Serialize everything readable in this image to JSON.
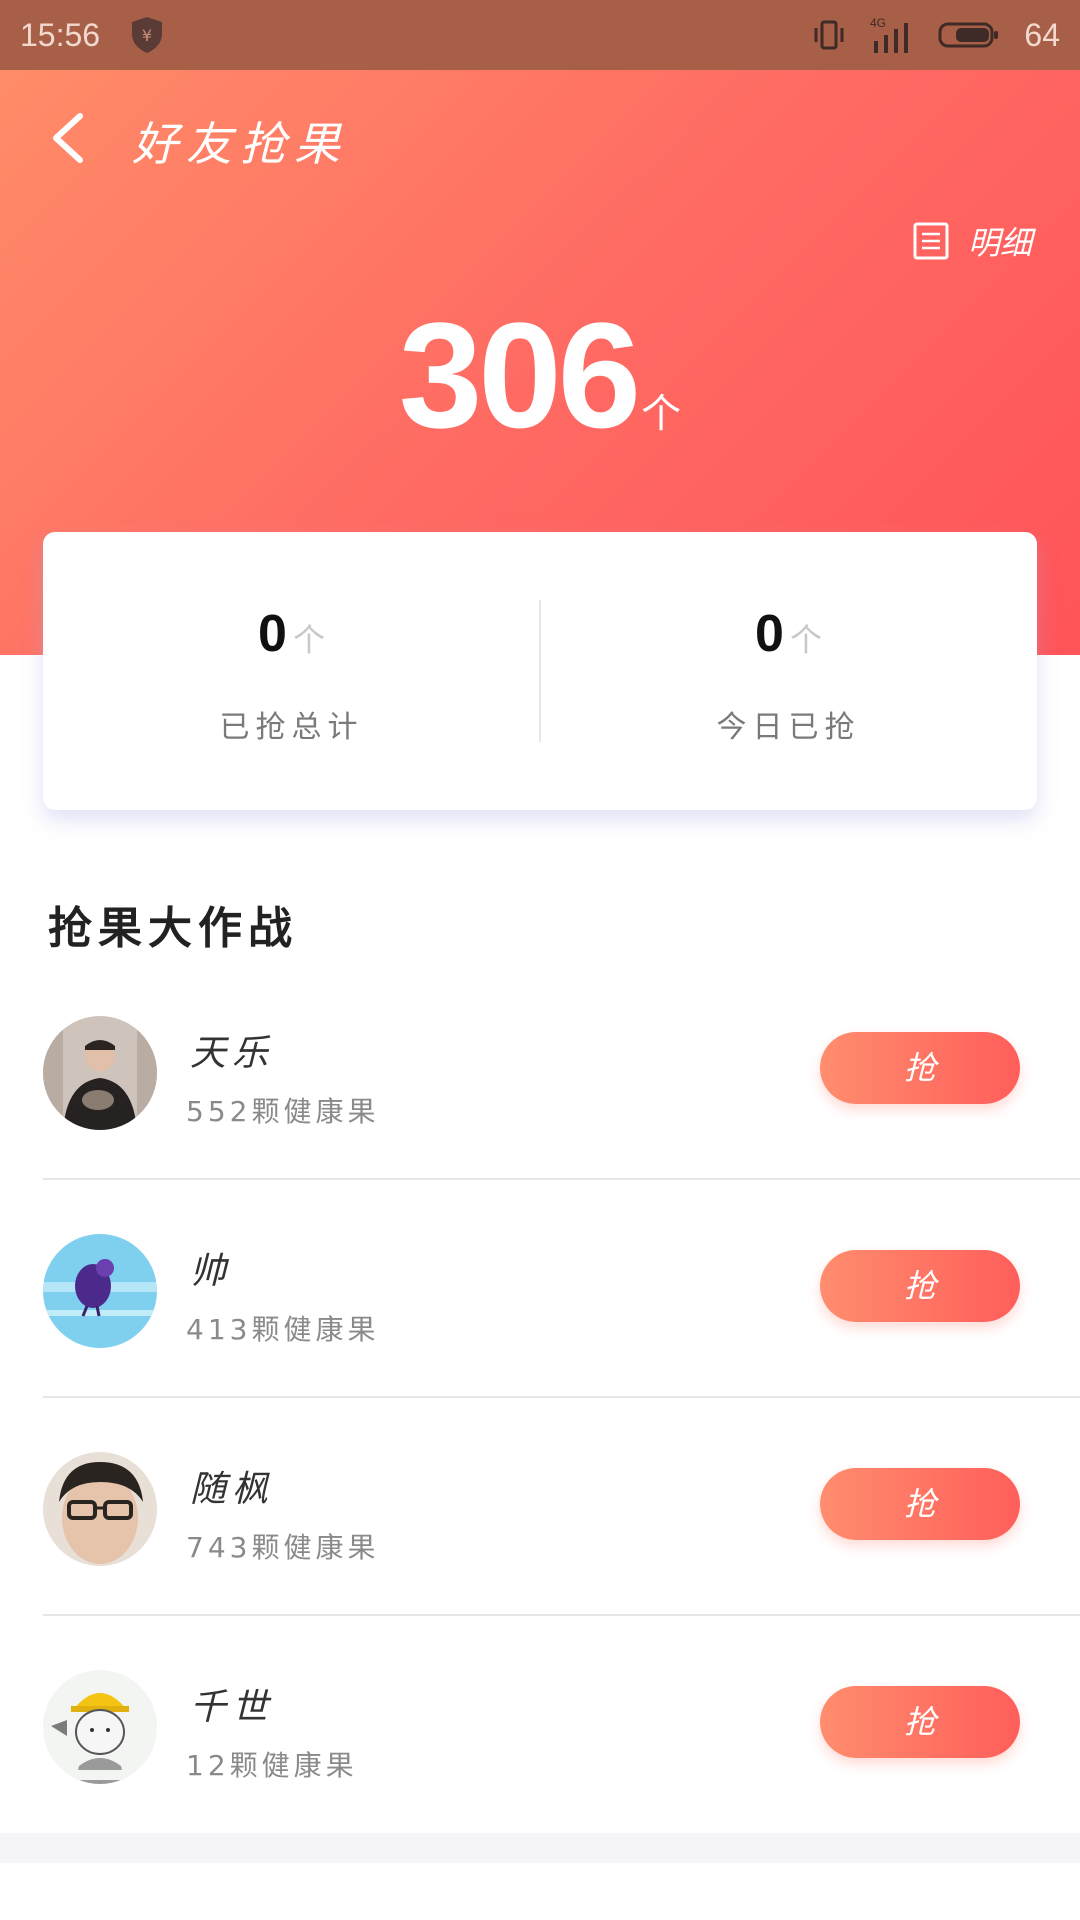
{
  "status_bar": {
    "time": "15:56",
    "network": "4G",
    "battery": "64",
    "icons": [
      "shield-yuan-icon",
      "vibrate-icon",
      "signal-icon",
      "battery-icon"
    ]
  },
  "header": {
    "title": "好友抢果",
    "detail_label": "明细"
  },
  "summary": {
    "total": "306",
    "unit": "个"
  },
  "stats": [
    {
      "value": "0",
      "unit": "个",
      "label": "已抢总计"
    },
    {
      "value": "0",
      "unit": "个",
      "label": "今日已抢"
    }
  ],
  "section": {
    "title": "抢果大作战"
  },
  "friends": [
    {
      "name": "天乐",
      "fruit": "552颗健康果",
      "button": "抢"
    },
    {
      "name": "帅",
      "fruit": "413颗健康果",
      "button": "抢"
    },
    {
      "name": "随枫",
      "fruit": "743颗健康果",
      "button": "抢"
    },
    {
      "name": "千世",
      "fruit": "12颗健康果",
      "button": "抢"
    }
  ],
  "colors": {
    "accent_start": "#ff8c68",
    "accent_end": "#ff5458",
    "status_bar": "#a85f47"
  }
}
